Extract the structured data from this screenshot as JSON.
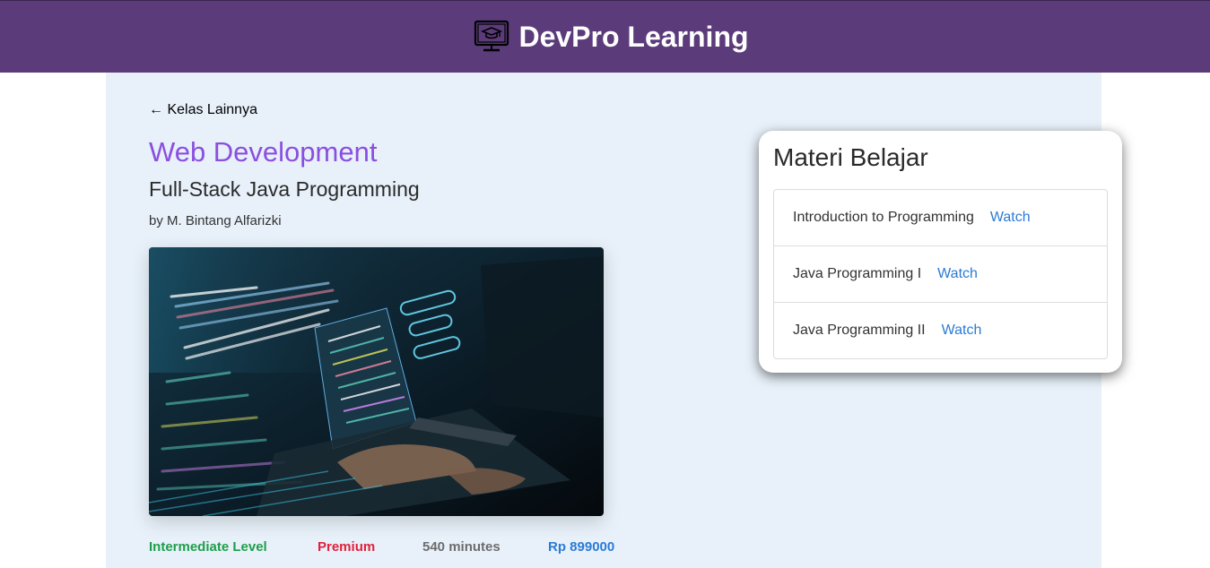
{
  "header": {
    "icon": "monitor-graduation-cap-icon",
    "title": "DevPro Learning",
    "background": "#5b3b7a"
  },
  "course": {
    "back_label": "← Kelas Lainnya",
    "category": "Web Development",
    "title": "Full-Stack Java Programming",
    "instructor": "by M. Bintang Alfarizki",
    "image": "code-screen-photo",
    "level": "Intermediate Level",
    "tier": "Premium",
    "duration": "540 minutes",
    "price": "Rp 899000",
    "colors": {
      "category": "#8a4fe0",
      "level": "#1e9e4a",
      "tier": "#e0203c",
      "duration": "#6c6c6c",
      "price": "#2b7bd6"
    }
  },
  "materials": {
    "title": "Materi Belajar",
    "watch_label": "Watch",
    "lessons": [
      {
        "name": "Introduction to Programming"
      },
      {
        "name": "Java Programming I"
      },
      {
        "name": "Java Programming II"
      }
    ]
  }
}
